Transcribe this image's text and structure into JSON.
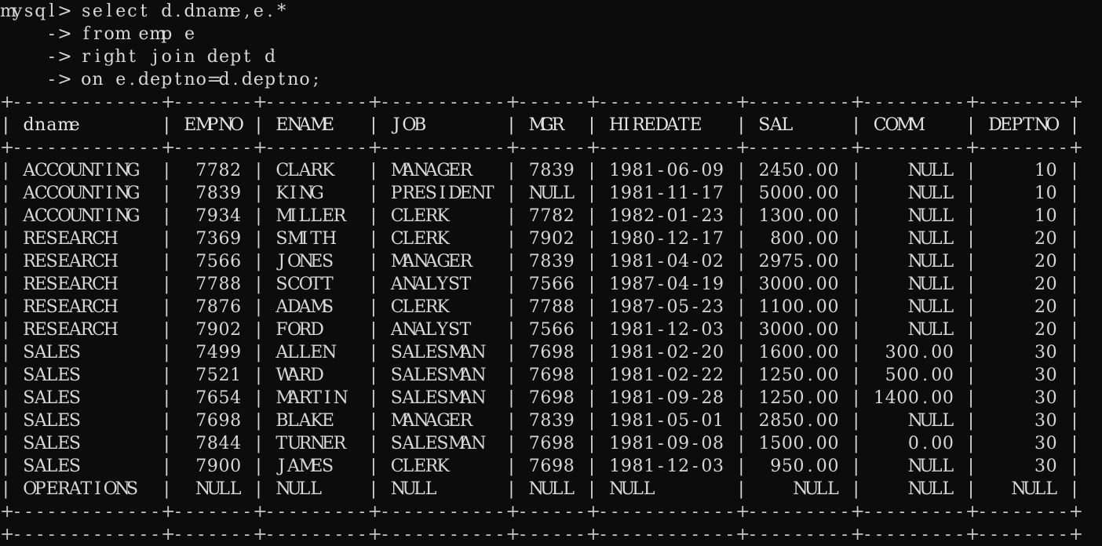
{
  "terminal": {
    "background_color": "#0c0c0c",
    "text_color": "#d8d8d8",
    "prompt": "mysql>",
    "continuation_prompt": "->"
  },
  "query": {
    "lines": [
      "mysql> select d.dname,e.*",
      "    -> from emp e",
      "    -> right join dept d",
      "    -> on e.deptno=d.deptno;"
    ],
    "statement": "select d.dname,e.* from emp e right join dept d on e.deptno=d.deptno;"
  },
  "result_table": {
    "columns": [
      {
        "name": "dname",
        "width": 13,
        "align": "left"
      },
      {
        "name": "EMPNO",
        "width": 7,
        "align": "right"
      },
      {
        "name": "ENAME",
        "width": 9,
        "align": "left"
      },
      {
        "name": "JOB",
        "width": 11,
        "align": "left"
      },
      {
        "name": "MGR",
        "width": 6,
        "align": "right"
      },
      {
        "name": "HIREDATE",
        "width": 12,
        "align": "left"
      },
      {
        "name": "SAL",
        "width": 9,
        "align": "right"
      },
      {
        "name": "COMM",
        "width": 9,
        "align": "right"
      },
      {
        "name": "DEPTNO",
        "width": 8,
        "align": "right"
      }
    ],
    "rows": [
      [
        "ACCOUNTING",
        "7782",
        "CLARK",
        "MANAGER",
        "7839",
        "1981-06-09",
        "2450.00",
        "NULL",
        "10"
      ],
      [
        "ACCOUNTING",
        "7839",
        "KING",
        "PRESIDENT",
        "NULL",
        "1981-11-17",
        "5000.00",
        "NULL",
        "10"
      ],
      [
        "ACCOUNTING",
        "7934",
        "MILLER",
        "CLERK",
        "7782",
        "1982-01-23",
        "1300.00",
        "NULL",
        "10"
      ],
      [
        "RESEARCH",
        "7369",
        "SMITH",
        "CLERK",
        "7902",
        "1980-12-17",
        "800.00",
        "NULL",
        "20"
      ],
      [
        "RESEARCH",
        "7566",
        "JONES",
        "MANAGER",
        "7839",
        "1981-04-02",
        "2975.00",
        "NULL",
        "20"
      ],
      [
        "RESEARCH",
        "7788",
        "SCOTT",
        "ANALYST",
        "7566",
        "1987-04-19",
        "3000.00",
        "NULL",
        "20"
      ],
      [
        "RESEARCH",
        "7876",
        "ADAMS",
        "CLERK",
        "7788",
        "1987-05-23",
        "1100.00",
        "NULL",
        "20"
      ],
      [
        "RESEARCH",
        "7902",
        "FORD",
        "ANALYST",
        "7566",
        "1981-12-03",
        "3000.00",
        "NULL",
        "20"
      ],
      [
        "SALES",
        "7499",
        "ALLEN",
        "SALESMAN",
        "7698",
        "1981-02-20",
        "1600.00",
        "300.00",
        "30"
      ],
      [
        "SALES",
        "7521",
        "WARD",
        "SALESMAN",
        "7698",
        "1981-02-22",
        "1250.00",
        "500.00",
        "30"
      ],
      [
        "SALES",
        "7654",
        "MARTIN",
        "SALESMAN",
        "7698",
        "1981-09-28",
        "1250.00",
        "1400.00",
        "30"
      ],
      [
        "SALES",
        "7698",
        "BLAKE",
        "MANAGER",
        "7839",
        "1981-05-01",
        "2850.00",
        "NULL",
        "30"
      ],
      [
        "SALES",
        "7844",
        "TURNER",
        "SALESMAN",
        "7698",
        "1981-09-08",
        "1500.00",
        "0.00",
        "30"
      ],
      [
        "SALES",
        "7900",
        "JAMES",
        "CLERK",
        "7698",
        "1981-12-03",
        "950.00",
        "NULL",
        "30"
      ],
      [
        "OPERATIONS",
        "NULL",
        "NULL",
        "NULL",
        "NULL",
        "NULL",
        "NULL",
        "NULL",
        "NULL"
      ]
    ],
    "null_token": "NULL",
    "row_count": 15
  }
}
